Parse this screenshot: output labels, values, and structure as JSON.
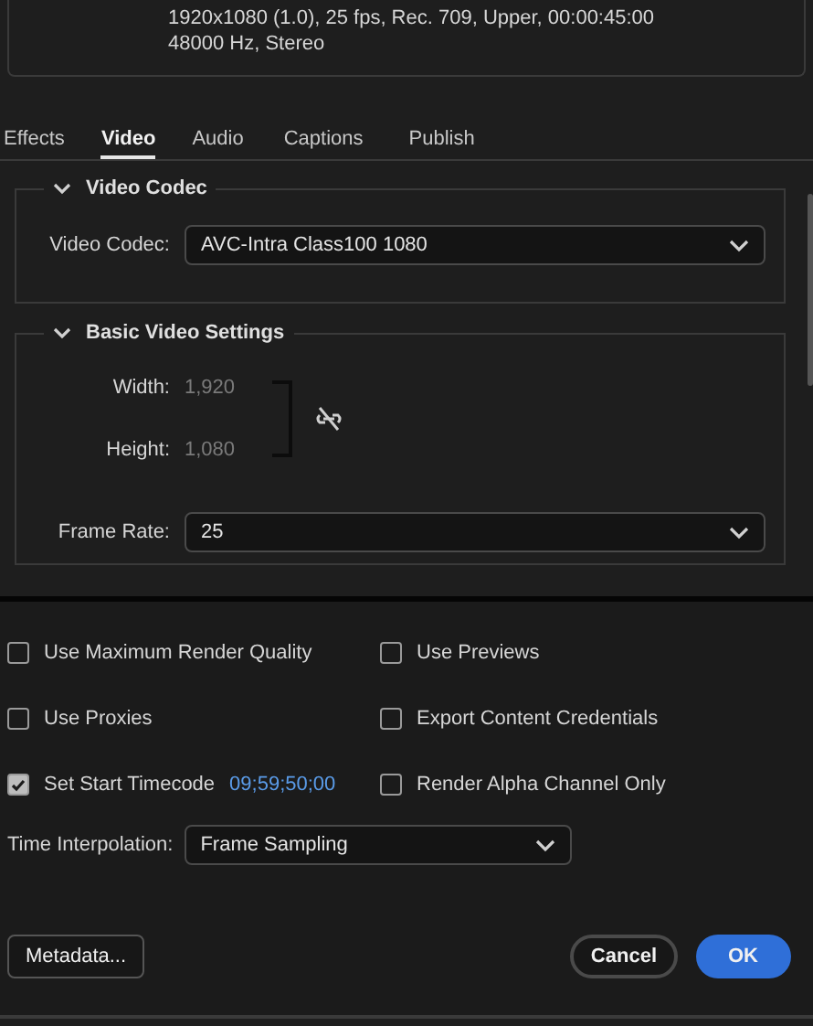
{
  "source_summary": {
    "lines": [
      "1920x1080 (1.0), 25 fps, Rec. 709, Upper, 00:00:45:00",
      "48000 Hz, Stereo"
    ]
  },
  "tabs": [
    {
      "label": "Effects",
      "selected": false
    },
    {
      "label": "Video",
      "selected": true
    },
    {
      "label": "Audio",
      "selected": false
    },
    {
      "label": "Captions",
      "selected": false
    },
    {
      "label": "Publish",
      "selected": false
    }
  ],
  "video_codec": {
    "title": "Video Codec",
    "expanded": true,
    "label": "Video Codec:",
    "value": "AVC-Intra Class100 1080"
  },
  "basic_video_settings": {
    "title": "Basic Video Settings",
    "expanded": true,
    "width_label": "Width:",
    "width_value": "1,920",
    "height_label": "Height:",
    "height_value": "1,080",
    "linked": false,
    "frame_rate_label": "Frame Rate:",
    "frame_rate_value": "25"
  },
  "options": [
    {
      "label": "Use Maximum Render Quality",
      "checked": false
    },
    {
      "label": "Use Previews",
      "checked": false
    },
    {
      "label": "Use Proxies",
      "checked": false
    },
    {
      "label": "Export Content Credentials",
      "checked": false
    },
    {
      "label": "Set Start Timecode",
      "checked": true,
      "value": "09;59;50;00"
    },
    {
      "label": "Render Alpha Channel Only",
      "checked": false
    }
  ],
  "time_interpolation": {
    "label": "Time Interpolation:",
    "value": "Frame Sampling"
  },
  "buttons": [
    {
      "label": "Metadata...",
      "kind": "secondary"
    },
    {
      "label": "Cancel",
      "kind": "cancel"
    },
    {
      "label": "OK",
      "kind": "primary"
    }
  ]
}
